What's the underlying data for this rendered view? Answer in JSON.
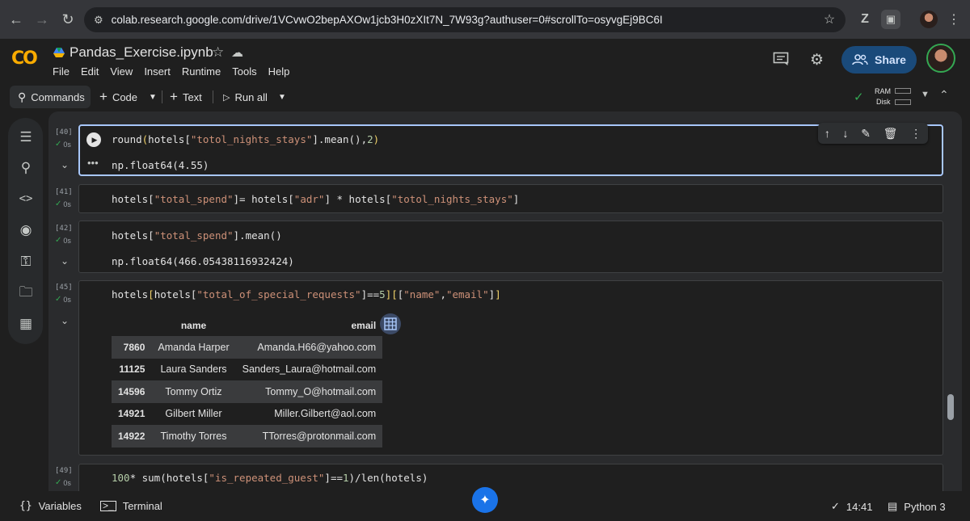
{
  "browser": {
    "url": "colab.research.google.com/drive/1VCvwO2bepAXOw1jcb3H0zXIt7N_7W93g?authuser=0#scrollTo=osyvgEj9BC6I"
  },
  "header": {
    "title": "Pandas_Exercise.ipynb",
    "menu": [
      "File",
      "Edit",
      "View",
      "Insert",
      "Runtime",
      "Tools",
      "Help"
    ],
    "share_label": "Share"
  },
  "toolbar": {
    "commands_label": "Commands",
    "code_label": "Code",
    "text_label": "Text",
    "run_all_label": "Run all",
    "ram_label": "RAM",
    "disk_label": "Disk"
  },
  "cells": [
    {
      "number": "[40]",
      "status": "0s",
      "output": "np.float64(4.55)"
    },
    {
      "number": "[41]",
      "status": "0s"
    },
    {
      "number": "[42]",
      "status": "0s",
      "output": "np.float64(466.05438116932424)"
    },
    {
      "number": "[45]",
      "status": "0s"
    },
    {
      "number": "[49]",
      "status": "0s"
    }
  ],
  "dataframe": {
    "columns": [
      "name",
      "email"
    ],
    "rows": [
      {
        "index": "7860",
        "name": "Amanda Harper",
        "email": "Amanda.H66@yahoo.com"
      },
      {
        "index": "11125",
        "name": "Laura Sanders",
        "email": "Sanders_Laura@hotmail.com"
      },
      {
        "index": "14596",
        "name": "Tommy Ortiz",
        "email": "Tommy_O@hotmail.com"
      },
      {
        "index": "14921",
        "name": "Gilbert Miller",
        "email": "Miller.Gilbert@aol.com"
      },
      {
        "index": "14922",
        "name": "Timothy Torres",
        "email": "TTorres@protonmail.com"
      }
    ]
  },
  "status_bar": {
    "variables_label": "Variables",
    "terminal_label": "Terminal",
    "time": "14:41",
    "runtime": "Python 3"
  },
  "colors": {
    "accent": "#1a4a7a",
    "success": "#34a853",
    "logo": "#f9ab00"
  }
}
